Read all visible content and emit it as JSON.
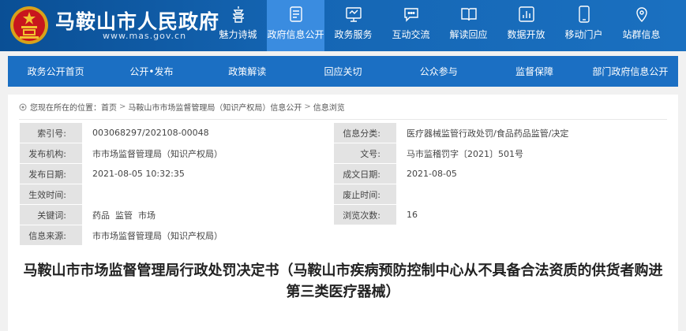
{
  "header": {
    "title": "马鞍山市人民政府",
    "url": "www.mas.gov.cn"
  },
  "nav": [
    {
      "label": "魅力诗城",
      "icon": "pagoda-icon"
    },
    {
      "label": "政府信息公开",
      "icon": "document-icon",
      "active": true
    },
    {
      "label": "政务服务",
      "icon": "monitor-icon"
    },
    {
      "label": "互动交流",
      "icon": "chat-icon"
    },
    {
      "label": "解读回应",
      "icon": "book-icon"
    },
    {
      "label": "数据开放",
      "icon": "bar-chart-icon"
    },
    {
      "label": "移动门户",
      "icon": "mobile-icon"
    },
    {
      "label": "站群信息",
      "icon": "location-pin-icon"
    }
  ],
  "subnav": [
    "政务公开首页",
    "公开•发布",
    "政策解读",
    "回应关切",
    "公众参与",
    "监督保障",
    "部门政府信息公开"
  ],
  "breadcrumb": {
    "prefix": "您现在所在的位置：",
    "items": [
      "首页",
      "马鞍山市市场监督管理局（知识产权局）信息公开",
      "信息浏览"
    ]
  },
  "meta": {
    "rows": [
      {
        "k1": "索引号:",
        "v1": "003068297/202108-00048",
        "k2": "信息分类:",
        "v2": "医疗器械监管行政处罚/食品药品监管/决定"
      },
      {
        "k1": "发布机构:",
        "v1": "市市场监督管理局（知识产权局）",
        "k2": "文号:",
        "v2": "马市监稽罚字〔2021〕501号"
      },
      {
        "k1": "发布日期:",
        "v1": "2021-08-05 10:32:35",
        "k2": "成文日期:",
        "v2": "2021-08-05"
      },
      {
        "k1": "生效时间:",
        "v1": "",
        "k2": "废止时间:",
        "v2": ""
      },
      {
        "k1": "关键词:",
        "v1": "药品  监管  市场",
        "k2": "浏览次数:",
        "v2": "16"
      }
    ],
    "source_label": "信息来源:",
    "source_value": "市市场监督管理局（知识产权局）"
  },
  "document": {
    "title": "马鞍山市市场监督管理局行政处罚决定书（马鞍山市疾病预防控制中心从不具备合法资质的供货者购进第三类医疗器械）"
  },
  "colors": {
    "header_bg": "#1566b4",
    "nav_active": "#3a8ce0",
    "subnav_bg": "#1b6fc3",
    "label_bg": "#e3e3e3"
  }
}
